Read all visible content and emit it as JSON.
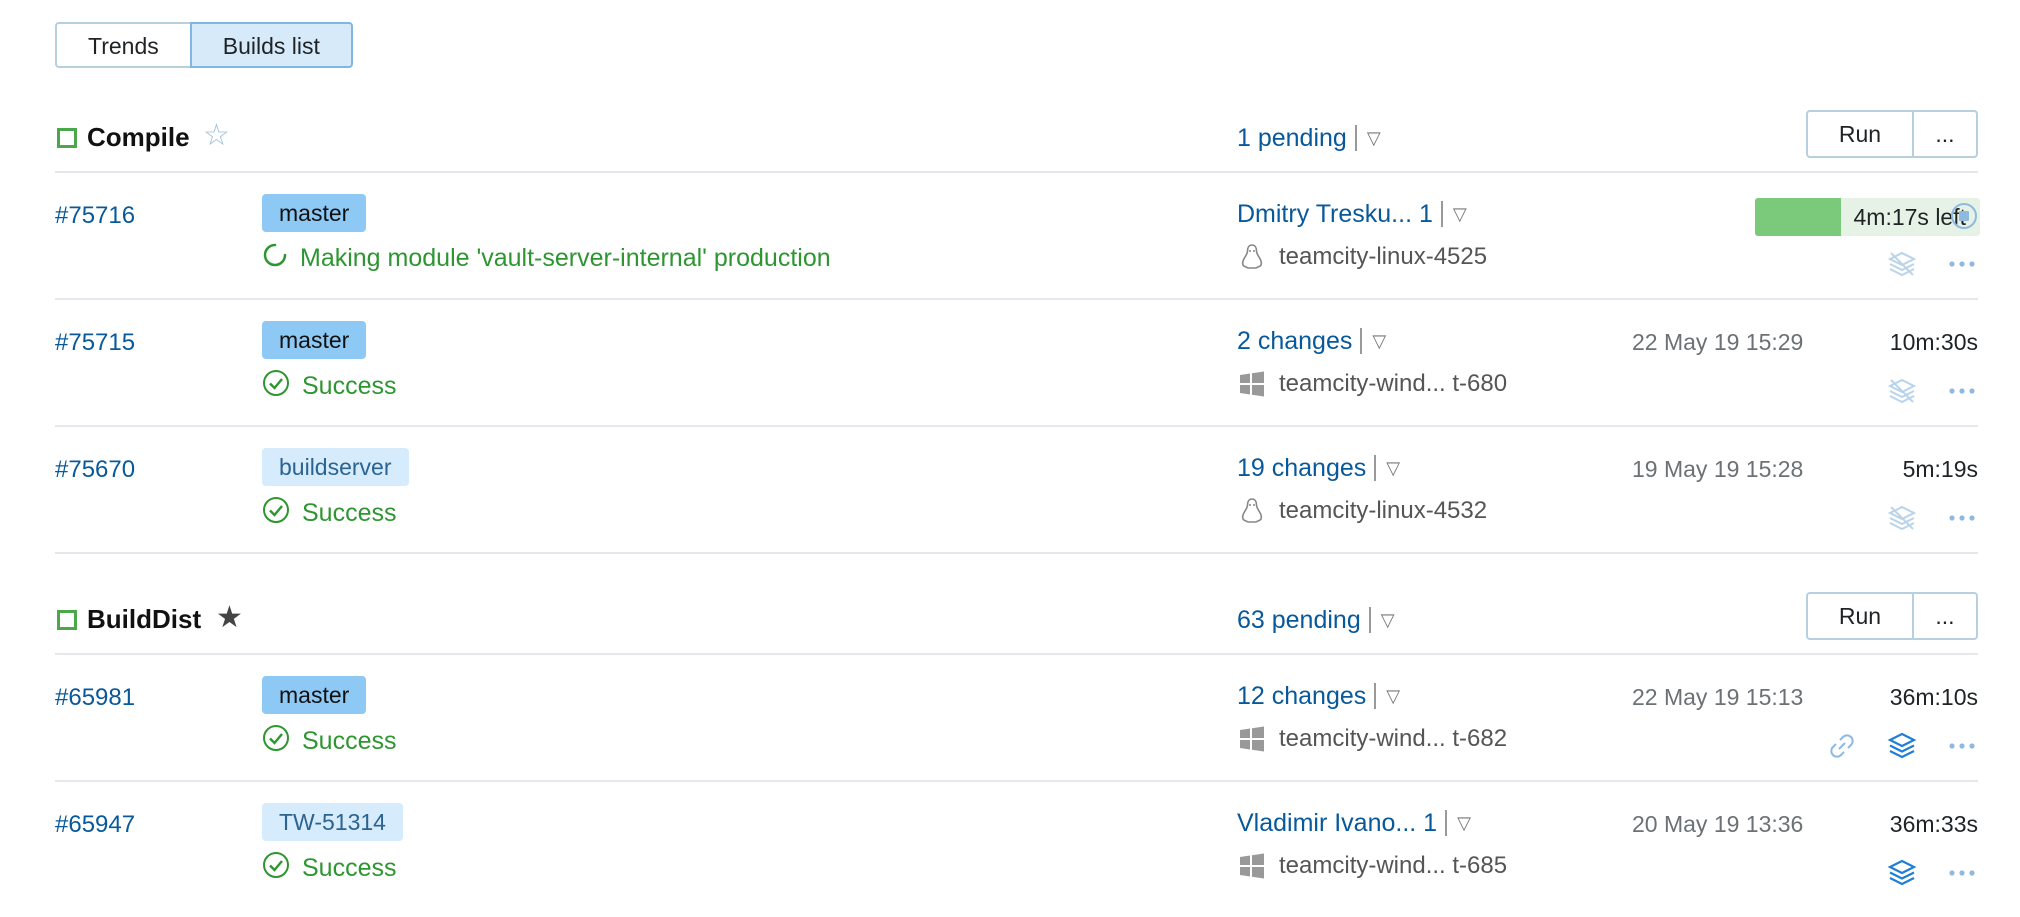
{
  "tabs": [
    "Trends",
    "Builds list"
  ],
  "sections": [
    {
      "name": "Compile",
      "starred": false,
      "pending": "1 pending",
      "run_label": "Run",
      "more_label": "...",
      "builds": [
        {
          "number": "#75716",
          "branch": "master",
          "branch_default": true,
          "status": "Making module 'vault-server-internal' production",
          "running": true,
          "changes": "Dmitry Tresku... 1",
          "agent": "teamcity-linux-4525",
          "agent_os": "linux",
          "progress_text": "4m:17s left",
          "progress_fraction": 0.38
        },
        {
          "number": "#75715",
          "branch": "master",
          "branch_default": true,
          "status": "Success",
          "changes": "2 changes",
          "agent": "teamcity-wind... t-680",
          "agent_os": "windows",
          "date": "22 May 19 15:29",
          "duration": "10m:30s"
        },
        {
          "number": "#75670",
          "branch": "buildserver",
          "branch_default": false,
          "status": "Success",
          "changes": "19 changes",
          "agent": "teamcity-linux-4532",
          "agent_os": "linux",
          "date": "19 May 19 15:28",
          "duration": "5m:19s"
        }
      ]
    },
    {
      "name": "BuildDist",
      "starred": true,
      "pending": "63 pending",
      "run_label": "Run",
      "more_label": "...",
      "builds": [
        {
          "number": "#65981",
          "branch": "master",
          "branch_default": true,
          "status": "Success",
          "changes": "12 changes",
          "agent": "teamcity-wind... t-682",
          "agent_os": "windows",
          "date": "22 May 19 15:13",
          "duration": "36m:10s"
        },
        {
          "number": "#65947",
          "branch": "TW-51314",
          "branch_default": false,
          "status": "Success",
          "changes": "Vladimir Ivano... 1",
          "agent": "teamcity-wind... t-685",
          "agent_os": "windows",
          "date": "20 May 19 13:36",
          "duration": "36m:33s"
        }
      ]
    }
  ],
  "colors": {
    "link": "#08599b",
    "success": "#2e9631",
    "progress_fill": "#7bc97b",
    "branch_default": "#8ec8f5",
    "branch_other": "#d6ebfb"
  }
}
